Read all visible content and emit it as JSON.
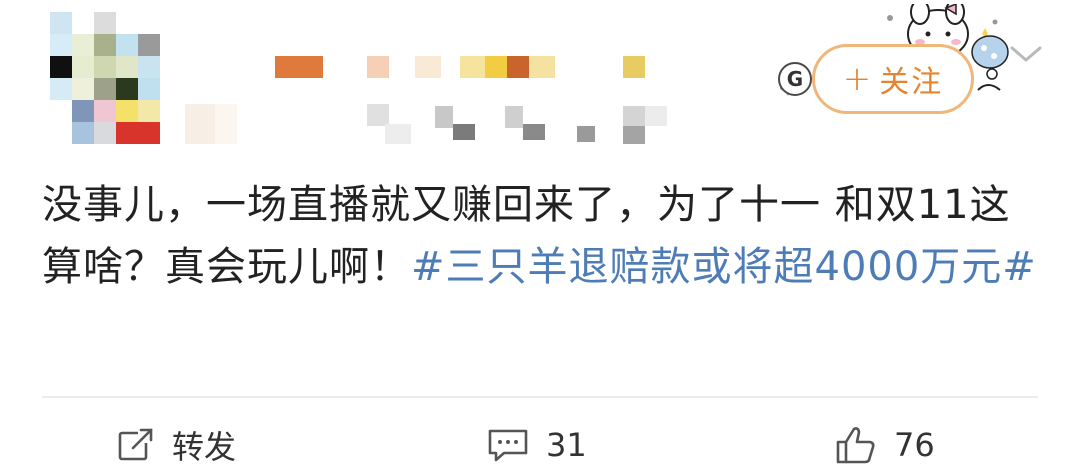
{
  "post": {
    "text": "没事儿，一场直播就又赚回来了，为了十一 和双11这算啥？真会玩儿啊！",
    "hashtag": "#三只羊退赔款或将超4000万元#"
  },
  "header": {
    "follow_label": "关注",
    "follow_plus": "+",
    "badge_letter": "G"
  },
  "actions": {
    "repost_label": "转发",
    "comment_count": "31",
    "like_count": "76"
  },
  "colors": {
    "accent_orange": "#e6832e",
    "hashtag_blue": "#4d7cb6",
    "text": "#222222"
  },
  "icons": {
    "repost": "repost-icon",
    "comment": "comment-icon",
    "like": "thumbs-up-icon",
    "more": "chevron-down-icon"
  }
}
